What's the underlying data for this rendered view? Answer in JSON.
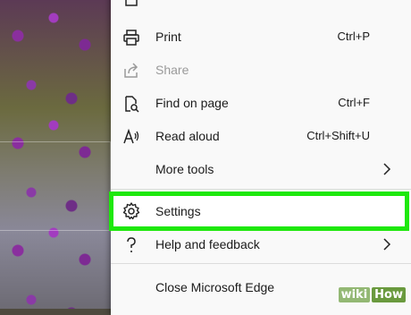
{
  "menu": {
    "items": [
      {
        "label": "Print",
        "shortcut": "Ctrl+P",
        "icon": "printer-icon",
        "enabled": true
      },
      {
        "label": "Share",
        "shortcut": "",
        "icon": "share-icon",
        "enabled": false
      },
      {
        "label": "Find on page",
        "shortcut": "Ctrl+F",
        "icon": "find-page-icon",
        "enabled": true
      },
      {
        "label": "Read aloud",
        "shortcut": "Ctrl+Shift+U",
        "icon": "read-aloud-icon",
        "enabled": true
      },
      {
        "label": "More tools",
        "shortcut": "",
        "icon": "",
        "enabled": true,
        "submenu": true
      },
      {
        "label": "Settings",
        "shortcut": "",
        "icon": "gear-icon",
        "enabled": true,
        "highlighted": true
      },
      {
        "label": "Help and feedback",
        "shortcut": "",
        "icon": "help-icon",
        "enabled": true,
        "submenu": true
      },
      {
        "label": "Close Microsoft Edge",
        "shortcut": "",
        "icon": "",
        "enabled": true
      }
    ]
  },
  "watermark": {
    "wiki": "wiki",
    "how": "How"
  },
  "colors": {
    "highlight_border": "#1ee80c",
    "menu_bg": "#f9f9f9",
    "text": "#1b1b1b",
    "disabled_text": "#9a9a9a"
  }
}
